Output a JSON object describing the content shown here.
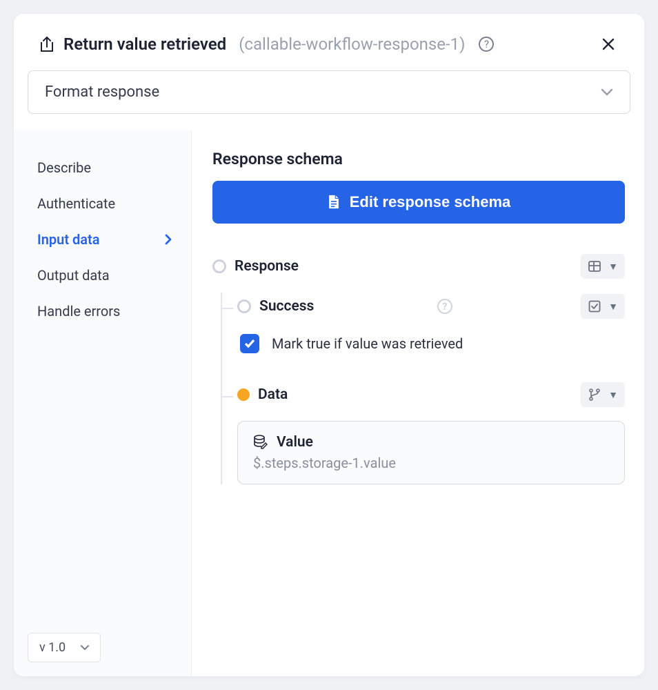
{
  "header": {
    "title": "Return value retrieved",
    "subtitle": "(callable-workflow-response-1)"
  },
  "dropdown": {
    "selected": "Format response"
  },
  "sidebar": {
    "items": [
      {
        "label": "Describe",
        "active": false
      },
      {
        "label": "Authenticate",
        "active": false
      },
      {
        "label": "Input data",
        "active": true
      },
      {
        "label": "Output data",
        "active": false
      },
      {
        "label": "Handle errors",
        "active": false
      }
    ]
  },
  "main": {
    "section_title": "Response schema",
    "edit_button": "Edit response schema",
    "tree": {
      "response_label": "Response",
      "success": {
        "label": "Success",
        "checkbox_label": "Mark true if value was retrieved",
        "checked": true
      },
      "data": {
        "label": "Data",
        "value_label": "Value",
        "value_path": "$.steps.storage-1.value"
      }
    }
  },
  "footer": {
    "version": "v 1.0"
  }
}
